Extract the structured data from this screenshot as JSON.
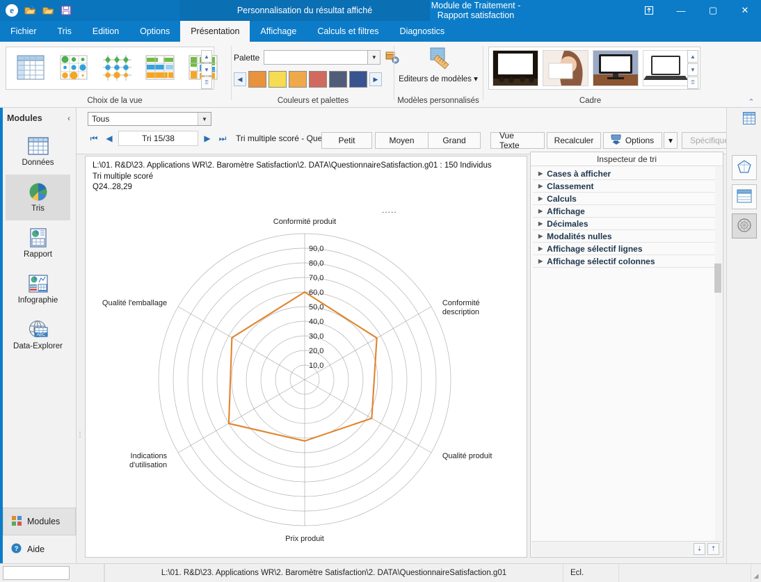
{
  "window": {
    "quick_access": [
      "app-icon",
      "open-icon",
      "open-folder-icon",
      "save-icon"
    ],
    "center_title": "Personnalisation du résultat affiché",
    "title": "Module de Traitement - Rapport satisfaction",
    "buttons": {
      "restore_window": "⊡",
      "minimize": "—",
      "maximize": "▢",
      "close": "✕"
    }
  },
  "menu": {
    "tabs": [
      {
        "label": "Fichier",
        "active": false
      },
      {
        "label": "Tris",
        "active": false
      },
      {
        "label": "Edition",
        "active": false
      },
      {
        "label": "Options",
        "active": false
      },
      {
        "label": "Présentation",
        "active": true
      },
      {
        "label": "Affichage",
        "active": false
      },
      {
        "label": "Calculs et filtres",
        "active": false
      },
      {
        "label": "Diagnostics",
        "active": false
      }
    ]
  },
  "ribbon": {
    "groups": [
      {
        "label": "Choix de la vue"
      },
      {
        "label": "Couleurs et palettes"
      },
      {
        "label": "Modèles personnalisés"
      },
      {
        "label": "Cadre"
      }
    ],
    "palette": {
      "label": "Palette",
      "value": "",
      "placeholder": ""
    },
    "palette_swatches": [
      "#e8923c",
      "#f5dc52",
      "#efa94a",
      "#d16a5e",
      "#515d78",
      "#39548f"
    ],
    "templates_button": "Editeurs de modèles",
    "collapse_ribbon": "⌃"
  },
  "sidebar": {
    "title": "Modules",
    "collapse": "‹",
    "items": [
      {
        "label": "Données",
        "icon": "table-icon",
        "active": false
      },
      {
        "label": "Tris",
        "icon": "pie-chart-icon",
        "active": true
      },
      {
        "label": "Rapport",
        "icon": "report-icon",
        "active": false
      },
      {
        "label": "Infographie",
        "icon": "infographic-icon",
        "active": false
      },
      {
        "label": "Data-Explorer",
        "icon": "globe-abc-icon",
        "active": false
      }
    ],
    "overflow": "⋮",
    "bottom": [
      {
        "label": "Modules",
        "icon": "modules-icon"
      },
      {
        "label": "Aide",
        "icon": "help-icon"
      }
    ]
  },
  "toolbar": {
    "filter_combo": {
      "value": "Tous"
    },
    "nav": {
      "first": "⏮",
      "prev": "◀",
      "next": "▶",
      "last": "⏭"
    },
    "tri_counter": "Tri 15/38",
    "tri_caption": "Tri multiple scoré - Questionn",
    "size_buttons": [
      "Petit",
      "Moyen",
      "Grand"
    ],
    "action_buttons": [
      "Vue Texte",
      "Recalculer"
    ],
    "options_button": "Options",
    "options_dropdown": "▾",
    "specific_button": "Spécifique",
    "undo_button": "↺"
  },
  "chart_header": {
    "line1": "L:\\01. R&D\\23. Applications WR\\2. Baromètre Satisfaction\\2. DATA\\QuestionnaireSatisfaction.g01 : 150 Individus",
    "line2": "Tri multiple scoré",
    "line3": "Q24..28,29",
    "marker": "....."
  },
  "chart_data": {
    "type": "radar",
    "title": "",
    "categories": [
      "Conformité produit",
      "Conformité description",
      "Qualité produit",
      "Prix produit",
      "Indications d'utilisation",
      "Qualité l'emballage"
    ],
    "series": [
      {
        "name": "Tri multiple scoré",
        "color": "#e0842c",
        "values": [
          60.0,
          57.0,
          53.0,
          42.0,
          60.0,
          57.5
        ]
      }
    ],
    "tick_labels": [
      "10,0",
      "20,0",
      "30,0",
      "40,0",
      "50,0",
      "60,0",
      "70,0",
      "80,0",
      "90,0"
    ],
    "tick_values": [
      10,
      20,
      30,
      40,
      50,
      60,
      70,
      80,
      90
    ],
    "rlim": [
      0,
      100
    ],
    "grid": true,
    "grid_color": "#9a9a9a",
    "legend": "none",
    "axis_label_color": "#222222"
  },
  "inspector": {
    "title": "Inspecteur de tri",
    "rows": [
      {
        "label": "Cases à afficher",
        "caret": "▶"
      },
      {
        "label": "Classement",
        "caret": "▶"
      },
      {
        "label": "Calculs",
        "caret": "▶"
      },
      {
        "label": "Affichage",
        "caret": "▶"
      },
      {
        "label": "Décimales",
        "caret": "▶"
      },
      {
        "label": "Modalités nulles",
        "caret": "▶"
      },
      {
        "label": "Affichage sélectif lignes",
        "caret": "▶"
      },
      {
        "label": "Affichage sélectif colonnes",
        "caret": "▶"
      }
    ],
    "footer_buttons": [
      "⇣",
      "⇡"
    ]
  },
  "rail": {
    "grid_icon": "grid-icon",
    "buttons": [
      {
        "icon": "shape-icon",
        "active": false
      },
      {
        "icon": "table-view-icon",
        "active": false
      },
      {
        "icon": "chart-view-icon",
        "active": true
      }
    ]
  },
  "statusbar": {
    "input_value": "",
    "path": "L:\\01. R&D\\23. Applications WR\\2. Baromètre Satisfaction\\2. DATA\\QuestionnaireSatisfaction.g01",
    "mode": "Ecl.",
    "grip": "◢"
  }
}
